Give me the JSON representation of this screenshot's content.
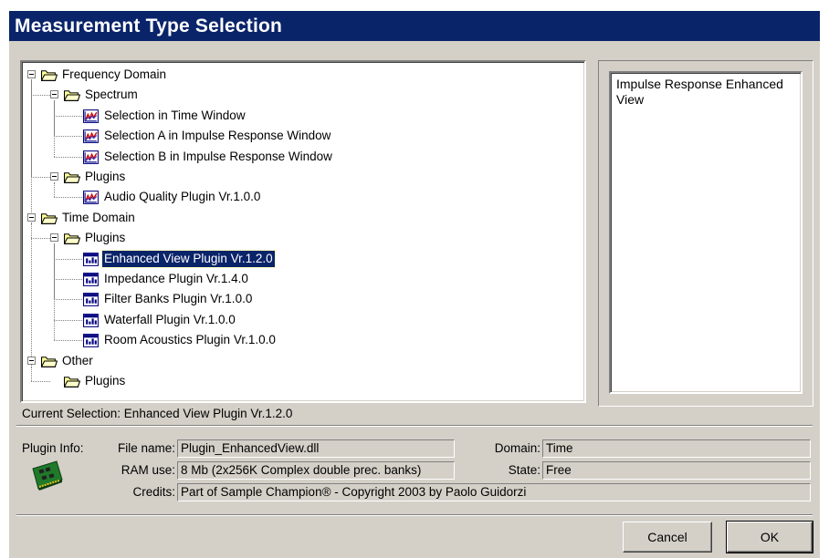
{
  "window": {
    "title": "Measurement Type Selection"
  },
  "tree": {
    "nodes": [
      {
        "label": "Frequency Domain",
        "type": "folder",
        "icon": "folder-open-icon"
      },
      {
        "label": "Spectrum",
        "type": "folder",
        "icon": "folder-open-icon"
      },
      {
        "label": "Selection in Time Window",
        "type": "item",
        "icon": "spectrum-graph-icon"
      },
      {
        "label": "Selection A in Impulse Response Window",
        "type": "item",
        "icon": "spectrum-graph-icon"
      },
      {
        "label": "Selection B in Impulse Response Window",
        "type": "item",
        "icon": "spectrum-graph-icon"
      },
      {
        "label": "Plugins",
        "type": "folder",
        "icon": "folder-open-icon"
      },
      {
        "label": "Audio Quality Plugin  Vr.1.0.0",
        "type": "item",
        "icon": "spectrum-graph-icon"
      },
      {
        "label": "Time Domain",
        "type": "folder",
        "icon": "folder-open-icon"
      },
      {
        "label": "Plugins",
        "type": "folder",
        "icon": "folder-open-icon"
      },
      {
        "label": "Enhanced View Plugin  Vr.1.2.0",
        "type": "item",
        "icon": "waveform-window-icon",
        "selected": true
      },
      {
        "label": "Impedance Plugin  Vr.1.4.0",
        "type": "item",
        "icon": "waveform-window-icon"
      },
      {
        "label": "Filter Banks Plugin  Vr.1.0.0",
        "type": "item",
        "icon": "waveform-window-icon"
      },
      {
        "label": "Waterfall Plugin  Vr.1.0.0",
        "type": "item",
        "icon": "waveform-window-icon"
      },
      {
        "label": "Room Acoustics Plugin  Vr.1.0.0",
        "type": "item",
        "icon": "waveform-window-icon"
      },
      {
        "label": "Other",
        "type": "folder",
        "icon": "folder-open-icon"
      },
      {
        "label": "Plugins",
        "type": "folder",
        "icon": "folder-open-icon"
      }
    ]
  },
  "description": {
    "text": "Impulse Response Enhanced View"
  },
  "status": {
    "current_selection": "Current Selection: Enhanced View Plugin  Vr.1.2.0"
  },
  "plugin_info": {
    "heading": "Plugin Info:",
    "icon": "circuit-board-icon",
    "file_name_label": "File name:",
    "file_name": "Plugin_EnhancedView.dll",
    "ram_label": "RAM use:",
    "ram": "8 Mb (2x256K Complex double prec. banks)",
    "credits_label": "Credits:",
    "credits": "Part of Sample Champion® - Copyright 2003 by Paolo Guidorzi",
    "domain_label": "Domain:",
    "domain": "Time",
    "state_label": "State:",
    "state": "Free"
  },
  "buttons": {
    "cancel": "Cancel",
    "ok": "OK"
  },
  "colors": {
    "title_bar": "#0a246a",
    "dialog_face": "#d4d0c8",
    "selection": "#0a246a"
  }
}
